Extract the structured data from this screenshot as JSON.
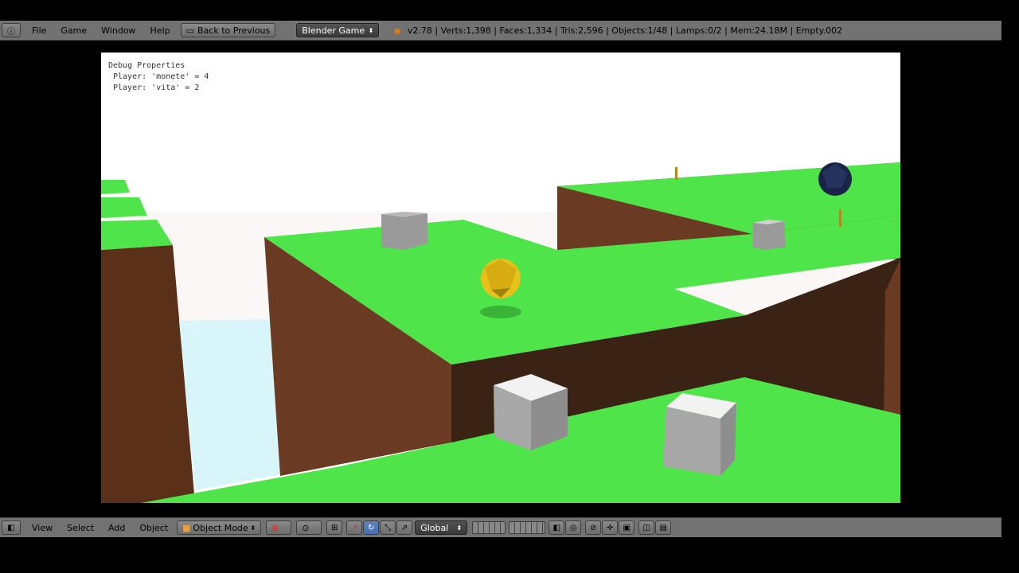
{
  "topbar": {
    "info_icon": "info-icon",
    "menus": [
      "File",
      "Game",
      "Window",
      "Help"
    ],
    "back_button": "Back to Previous",
    "engine_select": "Blender Game",
    "stats": "v2.78 | Verts:1,398 | Faces:1,334 | Tris:2,596 | Objects:1/48 | Lamps:0/2 | Mem:24.18M | Empty.002"
  },
  "viewport": {
    "debug_title": "Debug Properties",
    "debug_lines": [
      "Player: 'monete' = 4",
      "Player: 'vita' = 2"
    ],
    "colors": {
      "grass": "#4ee44a",
      "dirt": "#6b3a22",
      "water": "#d8f6f9",
      "sky": "#ffffff",
      "ball": "#e8c21a",
      "enemy": "#1a2448",
      "cube": "#c8c8c8"
    }
  },
  "botbar": {
    "editor_icon": "3d-view-icon",
    "menus": [
      "View",
      "Select",
      "Add",
      "Object"
    ],
    "mode_select": "Object Mode",
    "orientation_select": "Global"
  }
}
